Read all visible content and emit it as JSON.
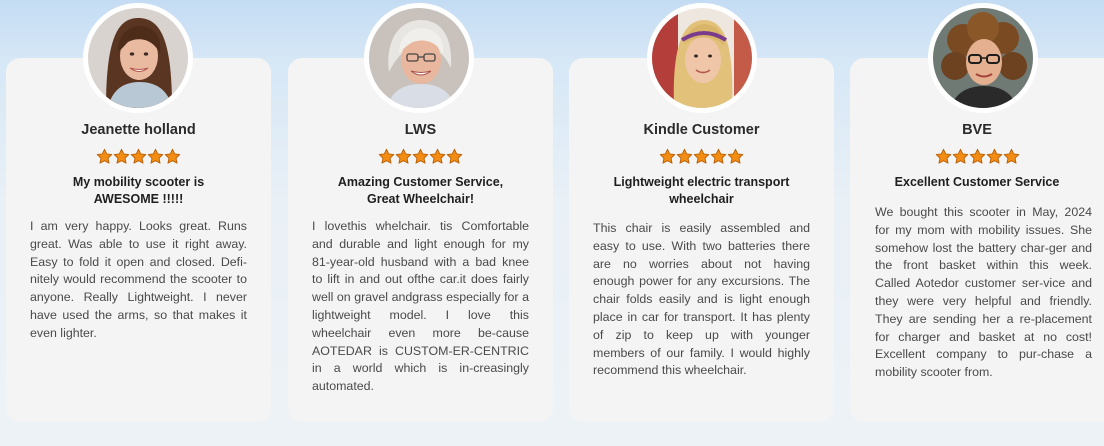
{
  "reviews": [
    {
      "name": "Jeanette holland",
      "rating": 5,
      "headline": "My mobility scooter is AWESOME !!!!!",
      "body": "I am very happy. Looks great. Runs great. Was able to use it right away. Easy to fold it open and closed. Defi-nitely would recommend the scooter to anyone. Really Lightweight. I never have used the arms, so that makes it even lighter.",
      "avatar_icon": "woman-brown-hair-portrait"
    },
    {
      "name": "LWS",
      "rating": 5,
      "headline": "Amazing Customer Service, Great Wheelchair!",
      "body": "I lovethis whelchair. tis Comfortable and durable and light enough for my 81-year-old husband with a bad knee to lift in and out ofthe car.it does fairly well on gravel andgrass especially for a lightweight model. I love this wheelchair even more be-cause AOTEDAR is CUSTOM-ER-CENTRIC in a world which is in-creasingly automated.",
      "avatar_icon": "older-woman-white-hair-portrait"
    },
    {
      "name": "Kindle Customer",
      "rating": 5,
      "headline": "Lightweight electric transport wheelchair",
      "body": "This chair is easily assembled and easy to use. With two batteries there are no worries about not having enough power for any excursions. The chair folds easily and is light enough place in car for transport. It has plenty of zip to keep up with younger members of our family. I would highly recommend this wheelchair.",
      "avatar_icon": "blonde-woman-headband-portrait"
    },
    {
      "name": "BVE",
      "rating": 5,
      "headline": "Excellent Customer Service",
      "body": "We bought this scooter in May, 2024 for my mom with mobility issues. She somehow lost the battery char-ger and the front basket within this week. Called Aotedor customer ser-vice and they were very helpful and friendly. They are sending her a re-placement for charger and basket at no cost! Excellent company to pur-chase a mobility scooter from.",
      "avatar_icon": "curly-hair-woman-glasses-portrait"
    }
  ],
  "colors": {
    "star_fill": "#f28c13",
    "star_stroke": "#b85f05",
    "card_bg": "#f4f4f4"
  }
}
